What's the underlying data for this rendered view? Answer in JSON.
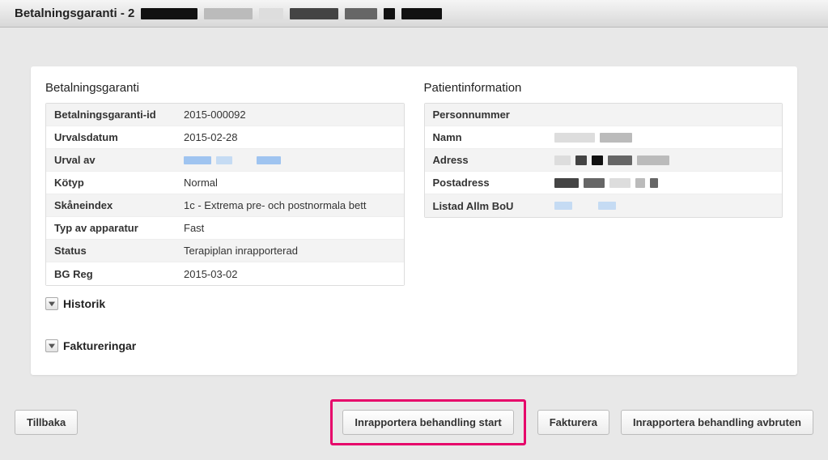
{
  "titlebar": {
    "prefix": "Betalningsgaranti - 2"
  },
  "guarantee": {
    "title": "Betalningsgaranti",
    "rows": [
      {
        "label": "Betalningsgaranti-id",
        "value": "2015-000092"
      },
      {
        "label": "Urvalsdatum",
        "value": "2015-02-28"
      },
      {
        "label": "Urval av",
        "value": ""
      },
      {
        "label": "Kötyp",
        "value": "Normal"
      },
      {
        "label": "Skåneindex",
        "value": "1c - Extrema pre- och postnormala bett"
      },
      {
        "label": "Typ av apparatur",
        "value": "Fast"
      },
      {
        "label": "Status",
        "value": "Terapiplan inrapporterad"
      },
      {
        "label": "BG Reg",
        "value": "2015-03-02"
      }
    ]
  },
  "patient": {
    "title": "Patientinformation",
    "rows": [
      {
        "label": "Personnummer",
        "value": ""
      },
      {
        "label": "Namn",
        "value": ""
      },
      {
        "label": "Adress",
        "value": ""
      },
      {
        "label": "Postadress",
        "value": ""
      },
      {
        "label": "Listad Allm BoU",
        "value": ""
      }
    ]
  },
  "expanders": {
    "history": "Historik",
    "invoicing": "Faktureringar"
  },
  "buttons": {
    "back": "Tillbaka",
    "report_start": "Inrapportera behandling start",
    "invoice": "Fakturera",
    "report_abort": "Inrapportera behandling avbruten"
  }
}
